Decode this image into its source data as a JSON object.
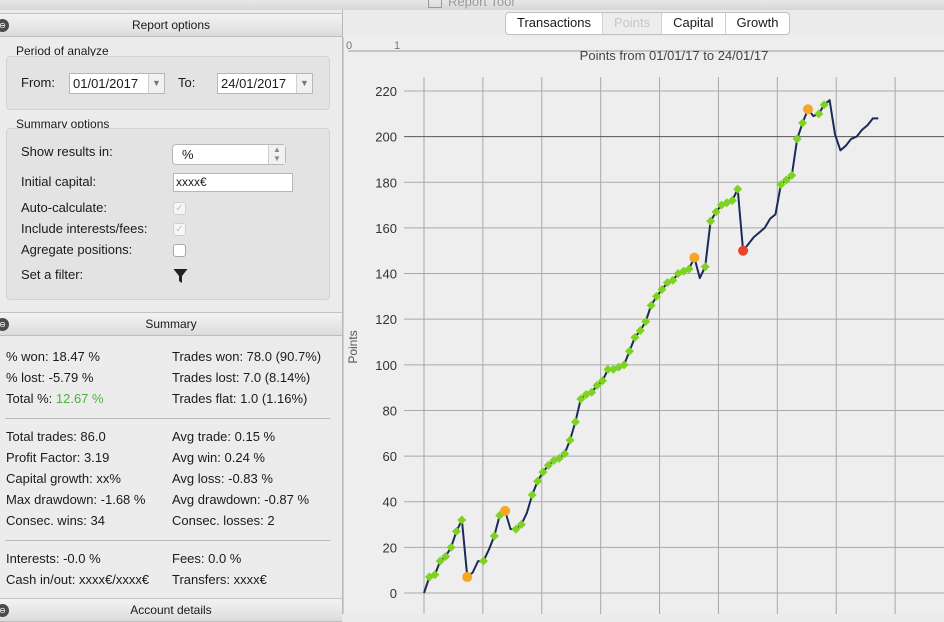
{
  "window": {
    "title": "Report Tool"
  },
  "report_options": {
    "header": "Report options",
    "period": {
      "title": "Period of analyze",
      "from_label": "From:",
      "from_value": "01/01/2017",
      "to_label": "To:",
      "to_value": "24/01/2017"
    },
    "summary_options": {
      "title": "Summary options",
      "show_results_label": "Show results in:",
      "show_results_value": "%",
      "initial_capital_label": "Initial capital:",
      "initial_capital_value": "xxxx€",
      "auto_calculate_label": "Auto-calculate:",
      "include_interests_label": "Include interests/fees:",
      "aggregate_label": "Agregate positions:",
      "filter_label": "Set a filter:"
    }
  },
  "summary": {
    "header": "Summary",
    "won_pct": "% won: 18.47 %",
    "lost_pct": "% lost: -5.79 %",
    "total_pct_label": "Total %:",
    "total_pct_value": "12.67 %",
    "trades_won": "Trades won: 78.0 (90.7%)",
    "trades_lost": "Trades lost: 7.0 (8.14%)",
    "trades_flat": "Trades flat: 1.0 (1.16%)",
    "total_trades": "Total trades: 86.0",
    "profit_factor": "Profit Factor: 3.19",
    "capital_growth": "Capital growth: xx%",
    "max_drawdown": "Max drawdown: -1.68 %",
    "consec_wins": "Consec. wins: 34",
    "avg_trade": "Avg trade: 0.15 %",
    "avg_win": "Avg win: 0.24 %",
    "avg_loss": "Avg loss: -0.83 %",
    "avg_drawdown": "Avg drawdown: -0.87 %",
    "consec_losses": "Consec. losses: 2",
    "interests": "Interests: -0.0 %",
    "fees": "Fees: 0.0 %",
    "cash_in_out": "Cash in/out: xxxx€/xxxx€",
    "transfers": "Transfers: xxxx€"
  },
  "account_details": {
    "header": "Account details"
  },
  "tabs": [
    {
      "label": "Transactions",
      "selected": false
    },
    {
      "label": "Points",
      "selected": true
    },
    {
      "label": "Capital",
      "selected": false
    },
    {
      "label": "Growth",
      "selected": false
    }
  ],
  "colors": {
    "line": "#1b2a57",
    "win_marker": "#7ed321",
    "loss_marker": "#f5a623",
    "worst_loss_marker": "#e8452c",
    "total_pct_green": "#49b33a"
  },
  "slider": {
    "min_label": "0",
    "max_label": "1"
  },
  "chart_data": {
    "type": "line",
    "title": "Points from 01/01/17 to 24/01/17",
    "ylabel": "Points",
    "xlabel": "",
    "ylim": [
      0,
      220
    ],
    "yticks": [
      0,
      20,
      40,
      60,
      80,
      100,
      120,
      140,
      160,
      180,
      200,
      220
    ],
    "grid": true,
    "x": [
      0,
      1,
      2,
      3,
      4,
      5,
      6,
      7,
      8,
      9,
      10,
      11,
      12,
      13,
      14,
      15,
      16,
      17,
      18,
      19,
      20,
      21,
      22,
      23,
      24,
      25,
      26,
      27,
      28,
      29,
      30,
      31,
      32,
      33,
      34,
      35,
      36,
      37,
      38,
      39,
      40,
      41,
      42,
      43,
      44,
      45,
      46,
      47,
      48,
      49,
      50,
      51,
      52,
      53,
      54,
      55,
      56,
      57,
      58,
      59,
      60,
      61,
      62,
      63,
      64,
      65,
      66,
      67,
      68,
      69,
      70,
      71,
      72,
      73,
      74,
      75,
      76,
      77,
      78,
      79,
      80,
      81,
      82,
      83,
      84,
      85,
      86,
      87,
      88,
      89,
      90,
      91,
      92,
      93,
      94,
      95,
      96,
      97,
      98
    ],
    "series": [
      {
        "values": [
          0,
          7,
          8,
          14,
          16,
          20,
          27,
          32,
          7,
          9,
          14,
          14,
          19,
          25,
          34,
          36,
          28,
          28,
          30,
          35,
          43,
          49,
          53,
          56,
          58,
          59,
          61,
          67,
          75,
          85,
          87,
          88,
          91,
          93,
          98,
          98,
          99,
          100,
          106,
          112,
          115,
          119,
          126,
          130,
          133,
          136,
          137,
          140,
          141,
          142,
          147,
          138,
          143,
          163,
          167,
          170,
          171,
          172,
          177,
          150,
          153,
          156,
          158,
          160,
          164,
          166,
          179,
          181,
          183,
          199,
          206,
          212,
          209,
          210,
          214,
          216,
          201,
          194,
          196,
          199,
          200,
          203,
          205,
          208,
          208
        ]
      }
    ],
    "win_points": [
      1,
      2,
      3,
      4,
      5,
      6,
      7,
      11,
      13,
      14,
      17,
      18,
      20,
      21,
      22,
      23,
      24,
      25,
      26,
      27,
      28,
      29,
      30,
      31,
      32,
      33,
      34,
      35,
      36,
      37,
      38,
      39,
      40,
      41,
      42,
      43,
      44,
      45,
      46,
      47,
      48,
      49,
      50,
      52,
      53,
      54,
      55,
      56,
      57,
      58,
      66,
      67,
      68,
      69,
      70,
      71,
      73,
      74
    ],
    "loss_points": [
      8,
      15,
      50,
      71
    ],
    "worst_loss_point": 59
  }
}
